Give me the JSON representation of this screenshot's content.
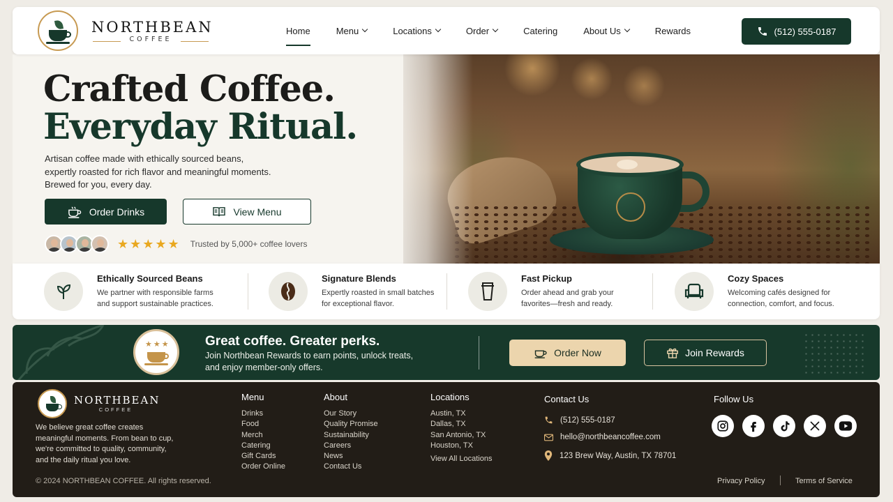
{
  "brand": {
    "name": "NORTHBEAN",
    "sub": "COFFEE"
  },
  "nav": {
    "items": [
      {
        "label": "Home",
        "active": true,
        "dropdown": false
      },
      {
        "label": "Menu",
        "dropdown": true
      },
      {
        "label": "Locations",
        "dropdown": true
      },
      {
        "label": "Order",
        "dropdown": true
      },
      {
        "label": "Catering",
        "dropdown": false
      },
      {
        "label": "About Us",
        "dropdown": true
      },
      {
        "label": "Rewards",
        "dropdown": false
      }
    ],
    "phone": "(512) 555-0187"
  },
  "hero": {
    "title_line1": "Crafted Coffee.",
    "title_line2": "Everyday Ritual.",
    "desc_line1": "Artisan coffee made with ethically sourced beans,",
    "desc_line2": "expertly roasted for rich flavor and meaningful moments.",
    "desc_line3": "Brewed for you, every day.",
    "primary_button": "Order Drinks",
    "secondary_button": "View Menu",
    "rating_stars": 5,
    "trust_text": "Trusted by 5,000+ coffee lovers"
  },
  "features": [
    {
      "title": "Ethically Sourced Beans",
      "desc_line1": "We partner with responsible farms",
      "desc_line2": "and support sustainable practices.",
      "icon": "leaf-icon"
    },
    {
      "title": "Signature Blends",
      "desc_line1": "Expertly roasted in small batches",
      "desc_line2": "for exceptional flavor.",
      "icon": "coffee-bean-icon"
    },
    {
      "title": "Fast Pickup",
      "desc_line1": "Order ahead and grab your",
      "desc_line2": "favorites—fresh and ready.",
      "icon": "takeaway-cup-icon"
    },
    {
      "title": "Cozy Spaces",
      "desc_line1": "Welcoming cafés designed for",
      "desc_line2": "connection, comfort, and focus.",
      "icon": "armchair-icon"
    }
  ],
  "rewards_banner": {
    "title": "Great coffee. Greater perks.",
    "text_line1": "Join Northbean Rewards to earn points, unlock treats,",
    "text_line2": "and enjoy member-only offers.",
    "order_button": "Order Now",
    "join_button": "Join Rewards"
  },
  "footer": {
    "about_line1": "We believe great coffee creates",
    "about_line2": "meaningful moments. From bean to cup,",
    "about_line3": "we're committed to quality, community,",
    "about_line4": "and the daily ritual you love.",
    "copyright": "© 2024 NORTHBEAN COFFEE. All rights reserved.",
    "menu": {
      "title": "Menu",
      "links": [
        "Drinks",
        "Food",
        "Merch",
        "Catering",
        "Gift Cards",
        "Order Online"
      ]
    },
    "about": {
      "title": "About",
      "links": [
        "Our Story",
        "Quality Promise",
        "Sustainability",
        "Careers",
        "News",
        "Contact Us"
      ]
    },
    "locations": {
      "title": "Locations",
      "links": [
        "Austin, TX",
        "Dallas, TX",
        "San Antonio, TX",
        "Houston, TX"
      ],
      "view_all": "View All Locations"
    },
    "contact": {
      "title": "Contact Us",
      "phone": "(512) 555-0187",
      "email": "hello@northbeancoffee.com",
      "address": "123 Brew Way, Austin, TX 78701"
    },
    "follow": {
      "title": "Follow Us",
      "networks": [
        "instagram-icon",
        "facebook-icon",
        "tiktok-icon",
        "x-icon",
        "youtube-icon"
      ]
    },
    "privacy": "Privacy Policy",
    "terms": "Terms of Service"
  },
  "colors": {
    "primary_green": "#16382b",
    "gold": "#c79a52",
    "cream_button": "#ecd5ad",
    "footer_bg": "#221d17"
  }
}
